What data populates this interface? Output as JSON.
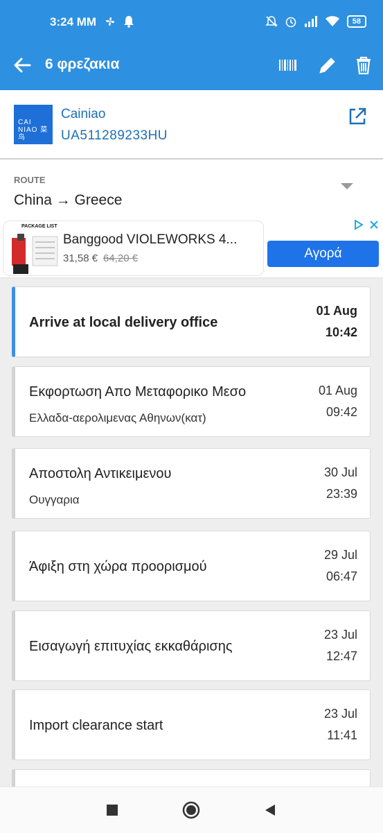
{
  "status_bar": {
    "time": "3:24 MM",
    "battery": "58"
  },
  "app_bar": {
    "title": "6 φρεζακια",
    "icons": [
      "back-arrow-icon",
      "barcode-icon",
      "edit-icon",
      "delete-icon"
    ]
  },
  "carrier": {
    "name": "Cainiao",
    "tracking_number": "UA511289233HU",
    "logo_line1": "CAI",
    "logo_line2": "NIAO 菜鸟"
  },
  "route": {
    "label": "ROUTE",
    "value": "China → Greece"
  },
  "ad": {
    "product": "Banggood VIOLEWORKS 4...",
    "price": "31,58 €",
    "old_price": "64,20 €",
    "buy_label": "Αγορά",
    "thumb_label": "PACKAGE LIST"
  },
  "events": [
    {
      "title": "Arrive at local delivery office",
      "location": "",
      "date": "01 Aug",
      "time": "10:42"
    },
    {
      "title": "Εκφορτωση Απο Μεταφορικο Μεσο",
      "location": "Ελλαδα-αερολιμενας Αθηνων(κατ)",
      "date": "01 Aug",
      "time": "09:42"
    },
    {
      "title": "Αποστολη Αντικειμενου",
      "location": "Ουγγαρια",
      "date": "30 Jul",
      "time": "23:39"
    },
    {
      "title": "Άφιξη στη χώρα προορισμού",
      "location": "",
      "date": "29 Jul",
      "time": "06:47"
    },
    {
      "title": "Εισαγωγή επιτυχίας εκκαθάρισης",
      "location": "",
      "date": "23 Jul",
      "time": "12:47"
    },
    {
      "title": "Import clearance start",
      "location": "",
      "date": "23 Jul",
      "time": "11:41"
    }
  ],
  "colors": {
    "primary": "#2e90e0",
    "accent_border": "#3f8fe6",
    "link": "#1c6fb8",
    "buy_button": "#1e73e8"
  }
}
